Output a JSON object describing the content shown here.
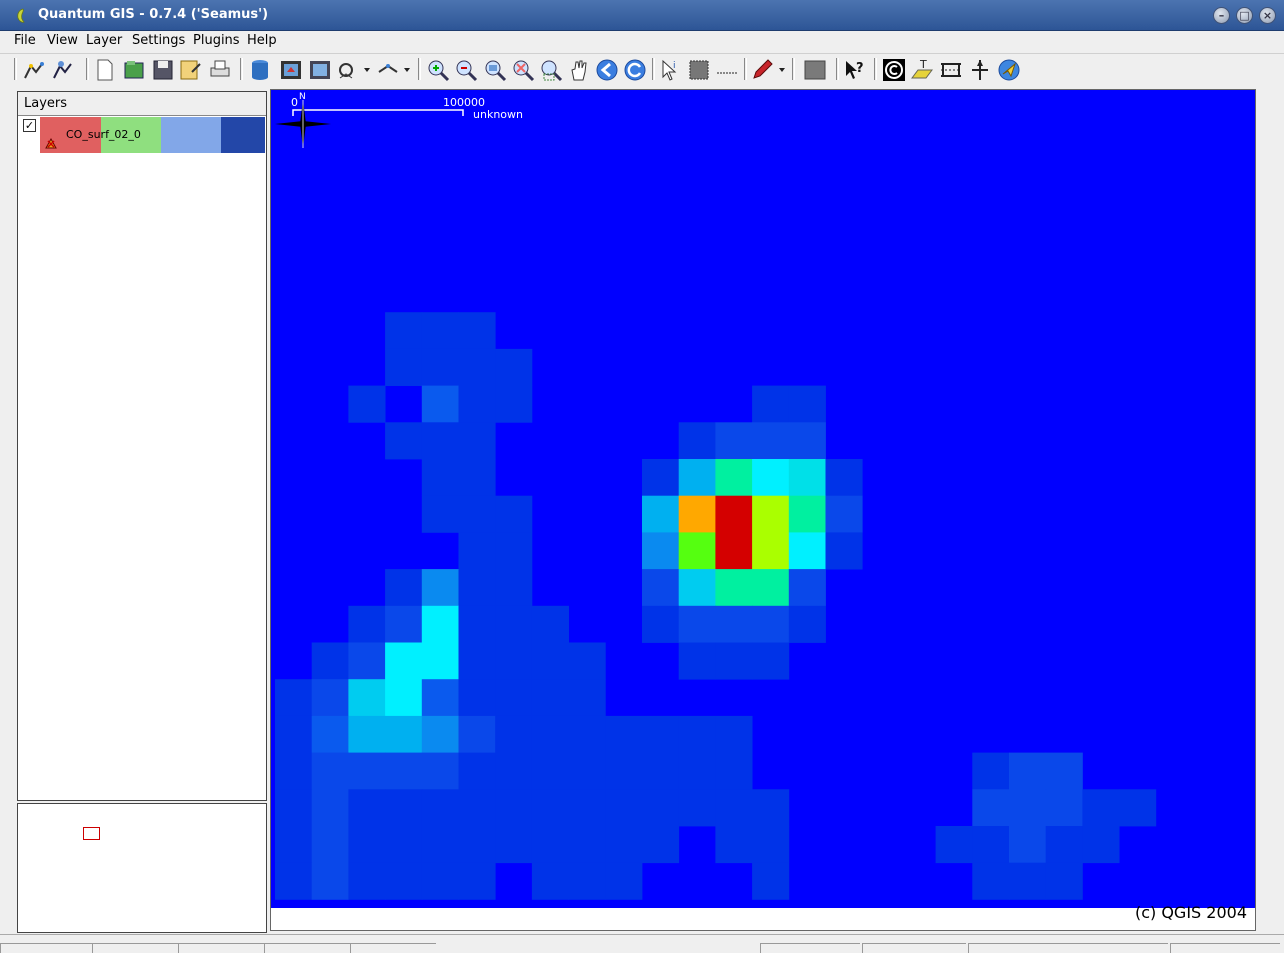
{
  "window": {
    "title": "Quantum GIS - 0.7.4 ('Seamus')"
  },
  "menu": [
    "File",
    "View",
    "Layer",
    "Settings",
    "Plugins",
    "Help"
  ],
  "toolbar_icons": [
    "add-vector-icon",
    "add-raster-icon",
    "new-project-icon",
    "open-project-icon",
    "save-project-icon",
    "save-as-icon",
    "print-icon",
    "add-postgis-icon",
    "map-composer-icon",
    "capture-icon",
    "identify-menu-icon",
    "digitize-menu-icon",
    "zoom-in-icon",
    "zoom-out-icon",
    "zoom-full-icon",
    "zoom-selection-icon",
    "zoom-layer-icon",
    "pan-icon",
    "zoom-last-icon",
    "refresh-icon",
    "identify-icon",
    "select-icon",
    "measure-icon",
    "edit-pencil-icon",
    "toggle-editing-icon",
    "whats-this-icon",
    "copyright-icon",
    "north-arrow-icon",
    "scale-bar-icon",
    "label-icon",
    "gps-icon"
  ],
  "legend": {
    "header": "Layers",
    "layer_name": "CO_surf_02_0",
    "layer_checked": "✓"
  },
  "map": {
    "background_color": "#0000ff",
    "scalebar": {
      "zero_label": "0",
      "distance_label": "100000",
      "unit_label": "unknown"
    },
    "copyright": "(c) QGIS 2004",
    "north_label": "N"
  }
}
